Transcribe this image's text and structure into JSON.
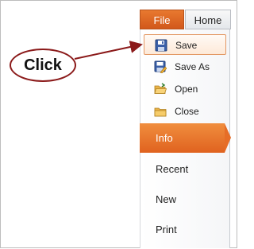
{
  "ribbon": {
    "tabs": [
      {
        "label": "File",
        "active": true
      },
      {
        "label": "Home",
        "active": false
      }
    ]
  },
  "backstage": {
    "commands": [
      {
        "label": "Save",
        "icon": "save-icon",
        "selected": true
      },
      {
        "label": "Save As",
        "icon": "save-as-icon",
        "selected": false
      },
      {
        "label": "Open",
        "icon": "open-folder-icon",
        "selected": false
      },
      {
        "label": "Close",
        "icon": "close-folder-icon",
        "selected": false
      }
    ],
    "nav": [
      {
        "label": "Info",
        "active": true
      },
      {
        "label": "Recent",
        "active": false
      },
      {
        "label": "New",
        "active": false
      },
      {
        "label": "Print",
        "active": false
      }
    ]
  },
  "callout": {
    "text": "Click"
  },
  "colors": {
    "accent": "#e0621f",
    "callout_border": "#8b1a1a"
  }
}
